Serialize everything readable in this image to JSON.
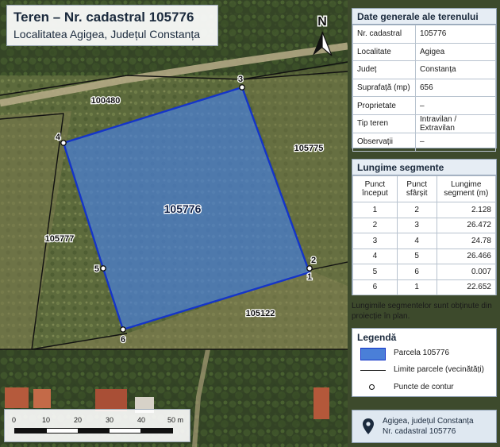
{
  "title": {
    "main": "Teren – Nr. cadastral 105776",
    "sub": "Localitatea Agigea, Județul Constanța"
  },
  "north_arrow": {
    "label": "N",
    "icon": "north-arrow-icon"
  },
  "map": {
    "parcel_label": "105776",
    "neighbours": [
      "100480",
      "105775",
      "105777",
      "105122"
    ],
    "points": [
      "1",
      "2",
      "3",
      "4",
      "5",
      "6"
    ],
    "colors": {
      "parcel_fill": "#4a7fd8",
      "parcel_stroke": "#1535c8",
      "boundary": "#111111"
    }
  },
  "general": {
    "heading": "Date generale ale terenului",
    "rows": [
      {
        "k": "Nr. cadastral",
        "v": "105776"
      },
      {
        "k": "Localitate",
        "v": "Agigea"
      },
      {
        "k": "Județ",
        "v": "Constanța"
      },
      {
        "k": "Suprafață (mp)",
        "v": "656"
      },
      {
        "k": "Proprietate",
        "v": "–"
      },
      {
        "k": "Tip teren",
        "v": "Intravilan / Extravilan"
      },
      {
        "k": "Observații",
        "v": "–"
      }
    ]
  },
  "segments": {
    "heading": "Lungime segmente",
    "headers": [
      "Punct început",
      "Punct sfârșit",
      "Lungime segment (m)"
    ],
    "rows": [
      [
        "1",
        "2",
        "2.128"
      ],
      [
        "2",
        "3",
        "26.472"
      ],
      [
        "3",
        "4",
        "24.78"
      ],
      [
        "4",
        "5",
        "26.466"
      ],
      [
        "5",
        "6",
        "0.007"
      ],
      [
        "6",
        "1",
        "22.652"
      ]
    ]
  },
  "note": "Lungimile segmentelor sunt obținute din proiecție în plan.",
  "legend": {
    "heading": "Legendă",
    "items": [
      {
        "label": "Parcela 105776",
        "symbol": "parcel-fill"
      },
      {
        "label": "Limite parcele (vecinătăți)",
        "symbol": "boundary-line"
      },
      {
        "label": "Puncte de contur",
        "symbol": "contour-point"
      }
    ]
  },
  "footer": {
    "icon": "location-pin-icon",
    "line1": "Agigea, județul Constanța",
    "line2": "Nr. cadastral 105776"
  },
  "scale_bar": {
    "ticks": [
      "0",
      "10",
      "20",
      "30",
      "40",
      "50 m"
    ]
  }
}
